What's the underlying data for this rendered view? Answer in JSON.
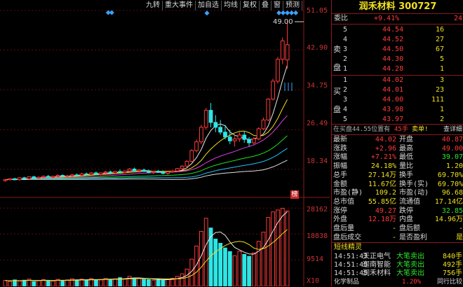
{
  "toolbar": [
    "九转",
    "重大事件",
    "加自选",
    "均线",
    "复权",
    "叠",
    "窗",
    "预测"
  ],
  "price_axis": [
    "51.05",
    "42.90",
    "34.75",
    "26.49",
    "18.34"
  ],
  "price_badge": "49.00",
  "mark_text": "榜",
  "vol_axis": [
    "28162",
    "18838",
    "9514",
    "X10"
  ],
  "stock": {
    "name": "润禾材料",
    "code": "300727"
  },
  "weibi": {
    "label": "委比",
    "pct": "+9.41%",
    "num": "24"
  },
  "sell_label": "卖盘",
  "buy_label": "买盘",
  "sells": [
    {
      "lvl": "5",
      "price": "44.54",
      "vol": "16"
    },
    {
      "lvl": "4",
      "price": "44.52",
      "vol": "27"
    },
    {
      "lvl": "3",
      "price": "44.50",
      "vol": "67"
    },
    {
      "lvl": "2",
      "price": "44.30",
      "vol": "5"
    },
    {
      "lvl": "1",
      "price": "44.28",
      "vol": "1"
    }
  ],
  "buys": [
    {
      "lvl": "1",
      "price": "44.02",
      "vol": "3"
    },
    {
      "lvl": "2",
      "price": "44.01",
      "vol": "23"
    },
    {
      "lvl": "3",
      "price": "44.00",
      "vol": "111"
    },
    {
      "lvl": "4",
      "price": "43.98",
      "vol": "1"
    },
    {
      "lvl": "5",
      "price": "43.97",
      "vol": "2"
    }
  ],
  "queue": {
    "text": "在买盘44.55位置有",
    "hands": "45手",
    "sell1": "卖单!",
    "detail": "查详细"
  },
  "stats": [
    {
      "l1": "最新",
      "v1": "44.02",
      "l2": "开盘",
      "v2": "40.87"
    },
    {
      "l1": "涨跌",
      "v1": "+2.96",
      "l2": "最高",
      "v2": "49.00"
    },
    {
      "l1": "涨幅",
      "v1": "+7.21%",
      "l2": "最低",
      "v2": "39.07"
    },
    {
      "l1": "振幅",
      "v1": "24.18%",
      "l2": "量比",
      "v2": "1.20"
    },
    {
      "l1": "总手",
      "v1": "27.14万",
      "l2": "换手",
      "v2": "69.70%"
    },
    {
      "l1": "金额",
      "v1": "11.67亿",
      "l2": "换手(实)",
      "v2": "69.70%"
    },
    {
      "l1": "市盈(静)",
      "v1": "109.2",
      "l2": "市盈(动)",
      "v2": "96.68"
    },
    {
      "l1": "总市值",
      "v1": "55.85亿",
      "l2": "流通值",
      "v2": "17.14亿"
    },
    {
      "l1": "涨停",
      "v1": "49.27",
      "l2": "跌停",
      "v2": "32.85"
    },
    {
      "l1": "外盘",
      "v1": "12.18万",
      "l2": "内盘",
      "v2": "14.96万"
    },
    {
      "l1": "盘后量",
      "v1": "-",
      "l2": "盘后额",
      "v2": "-"
    },
    {
      "l1": "盘后成交",
      "v1": "-",
      "l2": "是否盈利",
      "v2": "是"
    }
  ],
  "news_title": "短线精灵",
  "news": [
    {
      "time": "14:51:43",
      "name": "天正电气",
      "action": "大笔卖出",
      "num": "840手"
    },
    {
      "time": "14:51:45",
      "name": "迦南智能",
      "action": "大笔卖出",
      "num": "492手"
    },
    {
      "time": "14:51:45",
      "name": "润禾材料",
      "action": "大笔卖出",
      "num": "756手"
    }
  ],
  "bottom": {
    "sector": "化学制品",
    "pct": "1.20%",
    "link": "同行比较"
  },
  "colors": {
    "up": "#ff3b3b",
    "down": "#2ee6e6",
    "ma5": "#e8e8e8",
    "ma10": "#f0e020",
    "ma20": "#e040e0",
    "ma60": "#20e020",
    "ma120": "#20c0ff",
    "ma250": "#e0e0e0"
  },
  "chart_data": {
    "type": "candlestick",
    "price_range": [
      14.0,
      51.05
    ],
    "candles": [
      [
        16.0,
        16.3,
        15.8,
        16.2
      ],
      [
        16.2,
        16.5,
        16.0,
        16.4
      ],
      [
        16.4,
        16.6,
        16.1,
        16.2
      ],
      [
        16.2,
        16.7,
        16.0,
        16.6
      ],
      [
        16.6,
        16.8,
        16.3,
        16.4
      ],
      [
        16.4,
        16.9,
        16.2,
        16.8
      ],
      [
        16.8,
        17.0,
        16.4,
        16.5
      ],
      [
        16.5,
        16.9,
        16.3,
        16.7
      ],
      [
        16.7,
        17.1,
        16.5,
        16.9
      ],
      [
        16.9,
        17.2,
        16.6,
        16.7
      ],
      [
        16.7,
        17.0,
        16.4,
        16.9
      ],
      [
        16.9,
        17.3,
        16.7,
        17.1
      ],
      [
        17.1,
        17.3,
        16.8,
        16.9
      ],
      [
        16.9,
        17.2,
        16.6,
        17.0
      ],
      [
        17.0,
        17.4,
        16.8,
        17.2
      ],
      [
        17.2,
        17.5,
        17.0,
        17.1
      ],
      [
        17.1,
        17.6,
        16.9,
        17.4
      ],
      [
        17.4,
        17.7,
        17.1,
        17.3
      ],
      [
        17.3,
        17.8,
        17.1,
        17.6
      ],
      [
        17.6,
        17.9,
        17.2,
        17.3
      ],
      [
        17.3,
        17.7,
        17.1,
        17.6
      ],
      [
        17.6,
        18.0,
        17.4,
        17.8
      ],
      [
        17.8,
        18.1,
        17.5,
        17.6
      ],
      [
        17.6,
        18.0,
        17.4,
        17.9
      ],
      [
        17.9,
        18.3,
        17.6,
        17.7
      ],
      [
        17.7,
        18.1,
        17.5,
        18.0
      ],
      [
        18.0,
        18.6,
        17.8,
        18.4
      ],
      [
        18.4,
        18.7,
        17.9,
        18.0
      ],
      [
        18.0,
        18.4,
        17.7,
        18.2
      ],
      [
        18.2,
        18.5,
        17.8,
        17.9
      ],
      [
        17.9,
        18.3,
        17.5,
        17.7
      ],
      [
        17.7,
        18.0,
        17.4,
        17.9
      ],
      [
        17.9,
        18.2,
        17.6,
        17.8
      ],
      [
        17.8,
        18.1,
        17.3,
        17.5
      ],
      [
        17.5,
        17.9,
        17.2,
        17.8
      ],
      [
        17.8,
        18.2,
        17.6,
        18.0
      ],
      [
        18.0,
        18.6,
        17.9,
        18.5
      ],
      [
        18.5,
        19.2,
        18.3,
        19.0
      ],
      [
        19.0,
        20.2,
        18.8,
        20.0
      ],
      [
        20.0,
        22.5,
        19.8,
        22.2
      ],
      [
        22.2,
        24.5,
        21.8,
        24.0
      ],
      [
        24.0,
        27.5,
        23.5,
        27.0
      ],
      [
        27.0,
        31.0,
        26.5,
        30.5
      ],
      [
        30.5,
        32.0,
        27.0,
        28.0
      ],
      [
        28.0,
        29.5,
        26.0,
        27.0
      ],
      [
        27.0,
        28.5,
        25.5,
        26.0
      ],
      [
        26.0,
        27.5,
        24.5,
        25.0
      ],
      [
        25.0,
        26.5,
        23.5,
        24.2
      ],
      [
        24.2,
        25.2,
        23.0,
        24.6
      ],
      [
        24.6,
        26.0,
        24.0,
        25.4
      ],
      [
        25.4,
        26.2,
        23.8,
        24.5
      ],
      [
        24.5,
        25.0,
        23.0,
        23.8
      ],
      [
        23.8,
        25.0,
        23.5,
        24.6
      ],
      [
        24.6,
        27.0,
        24.3,
        26.7
      ],
      [
        26.7,
        29.0,
        26.4,
        28.5
      ],
      [
        28.5,
        33.0,
        28.3,
        32.8
      ],
      [
        32.8,
        37.0,
        32.5,
        36.5
      ],
      [
        36.5,
        41.5,
        36.0,
        41.0
      ],
      [
        41.0,
        45.5,
        40.0,
        44.8
      ],
      [
        40.87,
        49.0,
        39.07,
        44.02
      ]
    ],
    "volume_range": [
      0,
      30000
    ],
    "volumes": [
      2100,
      1800,
      2300,
      1900,
      2200,
      2600,
      1700,
      2000,
      2400,
      2100,
      1900,
      2500,
      2000,
      2300,
      2700,
      2200,
      2600,
      2100,
      2800,
      2400,
      2300,
      2900,
      2500,
      2700,
      3100,
      2600,
      3600,
      3000,
      2800,
      2500,
      2400,
      2200,
      2600,
      2300,
      2500,
      2900,
      3600,
      4500,
      6200,
      9800,
      14500,
      19800,
      24500,
      21000,
      17000,
      15500,
      13800,
      12500,
      11000,
      12600,
      11500,
      10800,
      12000,
      16200,
      19500,
      24800,
      26800,
      27500,
      28100,
      27140
    ],
    "ma_lines": [
      "MA5",
      "MA10",
      "MA20",
      "MA60",
      "MA120",
      "MA250"
    ]
  }
}
